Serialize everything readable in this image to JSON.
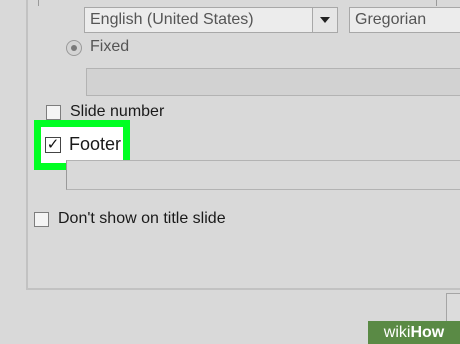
{
  "language_select": {
    "value": "English (United States)"
  },
  "calendar_select": {
    "value": "Gregorian"
  },
  "fixed": {
    "label": "Fixed",
    "field_value": ""
  },
  "slide_number": {
    "label": "Slide number",
    "checked": false
  },
  "footer": {
    "label": "Footer",
    "checked": true,
    "field_value": ""
  },
  "title_slide": {
    "label": "Don't show on title slide",
    "checked": false
  },
  "highlight_color": "#00ff22",
  "watermark": {
    "prefix": "wiki",
    "suffix": "How"
  },
  "icons": {
    "dropdown": "chevron-down-icon",
    "checkmark": "check-icon"
  }
}
